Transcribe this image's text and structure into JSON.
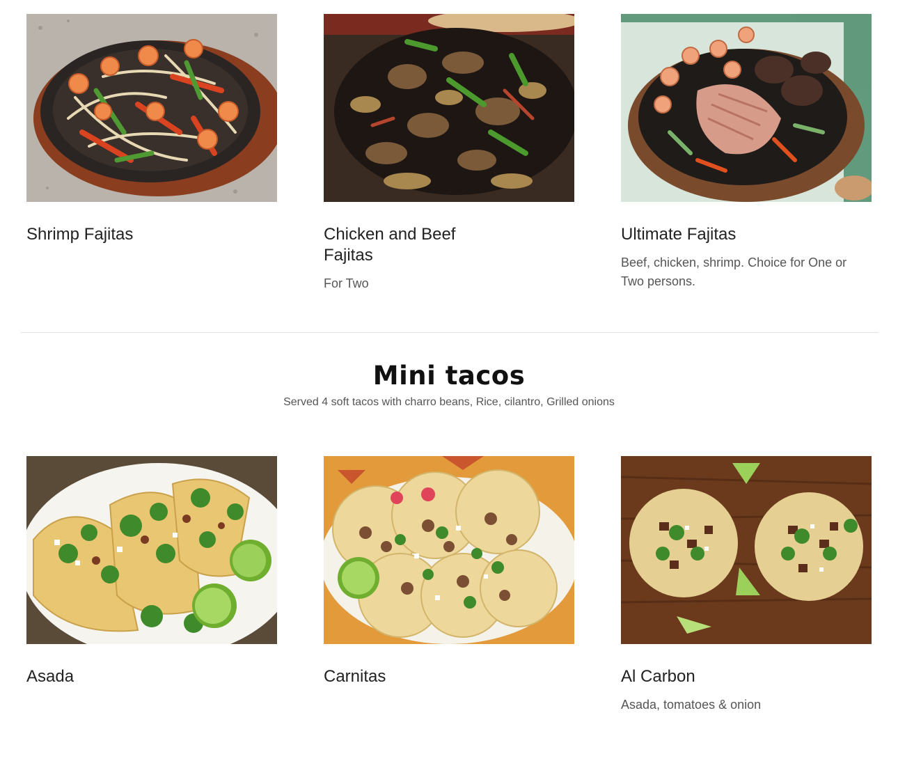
{
  "fajitas": {
    "items": [
      {
        "title": "Shrimp Fajitas",
        "description": "",
        "image": "shrimp-fajitas-photo"
      },
      {
        "title": "Chicken and Beef Fajitas",
        "description": "For Two",
        "image": "chicken-beef-fajitas-photo"
      },
      {
        "title": "Ultimate Fajitas",
        "description": "Beef, chicken, shrimp. Choice for One or Two persons.",
        "image": "ultimate-fajitas-photo"
      }
    ]
  },
  "mini_tacos": {
    "title": "Mini tacos",
    "subtitle": "Served 4 soft tacos with charro beans, Rice, cilantro, Grilled onions",
    "items": [
      {
        "title": "Asada",
        "description": "",
        "image": "asada-tacos-photo"
      },
      {
        "title": "Carnitas",
        "description": "",
        "image": "carnitas-tacos-photo"
      },
      {
        "title": "Al Carbon",
        "description": "Asada, tomatoes & onion",
        "image": "al-carbon-tacos-photo"
      }
    ]
  },
  "colors": {
    "title_text": "#222222",
    "description_text": "#555555",
    "divider": "#e3e3e3"
  }
}
